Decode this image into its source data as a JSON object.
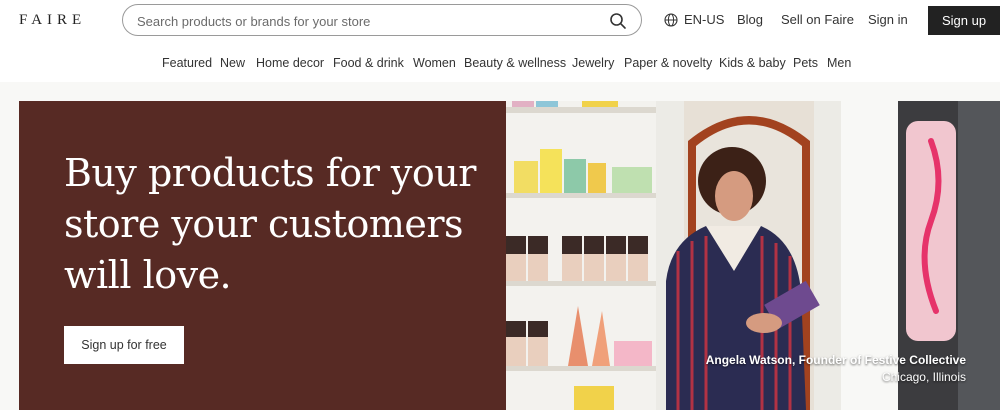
{
  "header": {
    "logo": "FAIRE",
    "search_placeholder": "Search products or brands for your store",
    "language": "EN-US",
    "blog": "Blog",
    "sell": "Sell on Faire",
    "sign_in": "Sign in",
    "sign_up": "Sign up"
  },
  "categories": [
    "Featured",
    "New",
    "Home decor",
    "Food & drink",
    "Women",
    "Beauty & wellness",
    "Jewelry",
    "Paper & novelty",
    "Kids & baby",
    "Pets",
    "Men"
  ],
  "hero": {
    "title": "Buy products for your store your customers will love.",
    "cta": "Sign up for free",
    "caption_name": "Angela Watson, Founder of Festive Collective",
    "caption_location": "Chicago, Illinois"
  },
  "colors": {
    "hero_background": "#572a24",
    "signup_button": "#222222"
  },
  "icons": [
    "search-icon",
    "globe-icon"
  ]
}
